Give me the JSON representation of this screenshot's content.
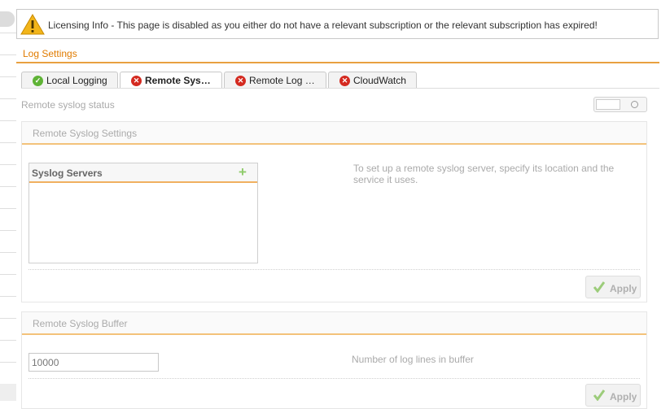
{
  "banner": {
    "message": "Licensing Info - This page is disabled as you either do not have a relevant subscription or the relevant subscription has expired!",
    "icon": "warning-icon"
  },
  "section": {
    "title": "Log Settings"
  },
  "tabs": [
    {
      "label": "Local Logging",
      "status": "ok",
      "active": false
    },
    {
      "label": "Remote Sys…",
      "status": "error",
      "active": true
    },
    {
      "label": "Remote Log …",
      "status": "error",
      "active": false
    },
    {
      "label": "CloudWatch",
      "status": "error",
      "active": false
    }
  ],
  "remote_syslog_status": {
    "label": "Remote syslog status",
    "enabled": false
  },
  "remote_syslog_settings": {
    "title": "Remote Syslog Settings",
    "servers_list": {
      "title": "Syslog Servers",
      "items": []
    },
    "help": "To set up a remote syslog server, specify its location and the service it uses.",
    "apply_label": "Apply"
  },
  "remote_syslog_buffer": {
    "title": "Remote Syslog Buffer",
    "value": "10000",
    "help": "Number of log lines in buffer",
    "apply_label": "Apply"
  },
  "colors": {
    "accent": "#e07b00",
    "ok": "#5fb336",
    "error": "#d42a20",
    "add": "#8ecb6a"
  }
}
